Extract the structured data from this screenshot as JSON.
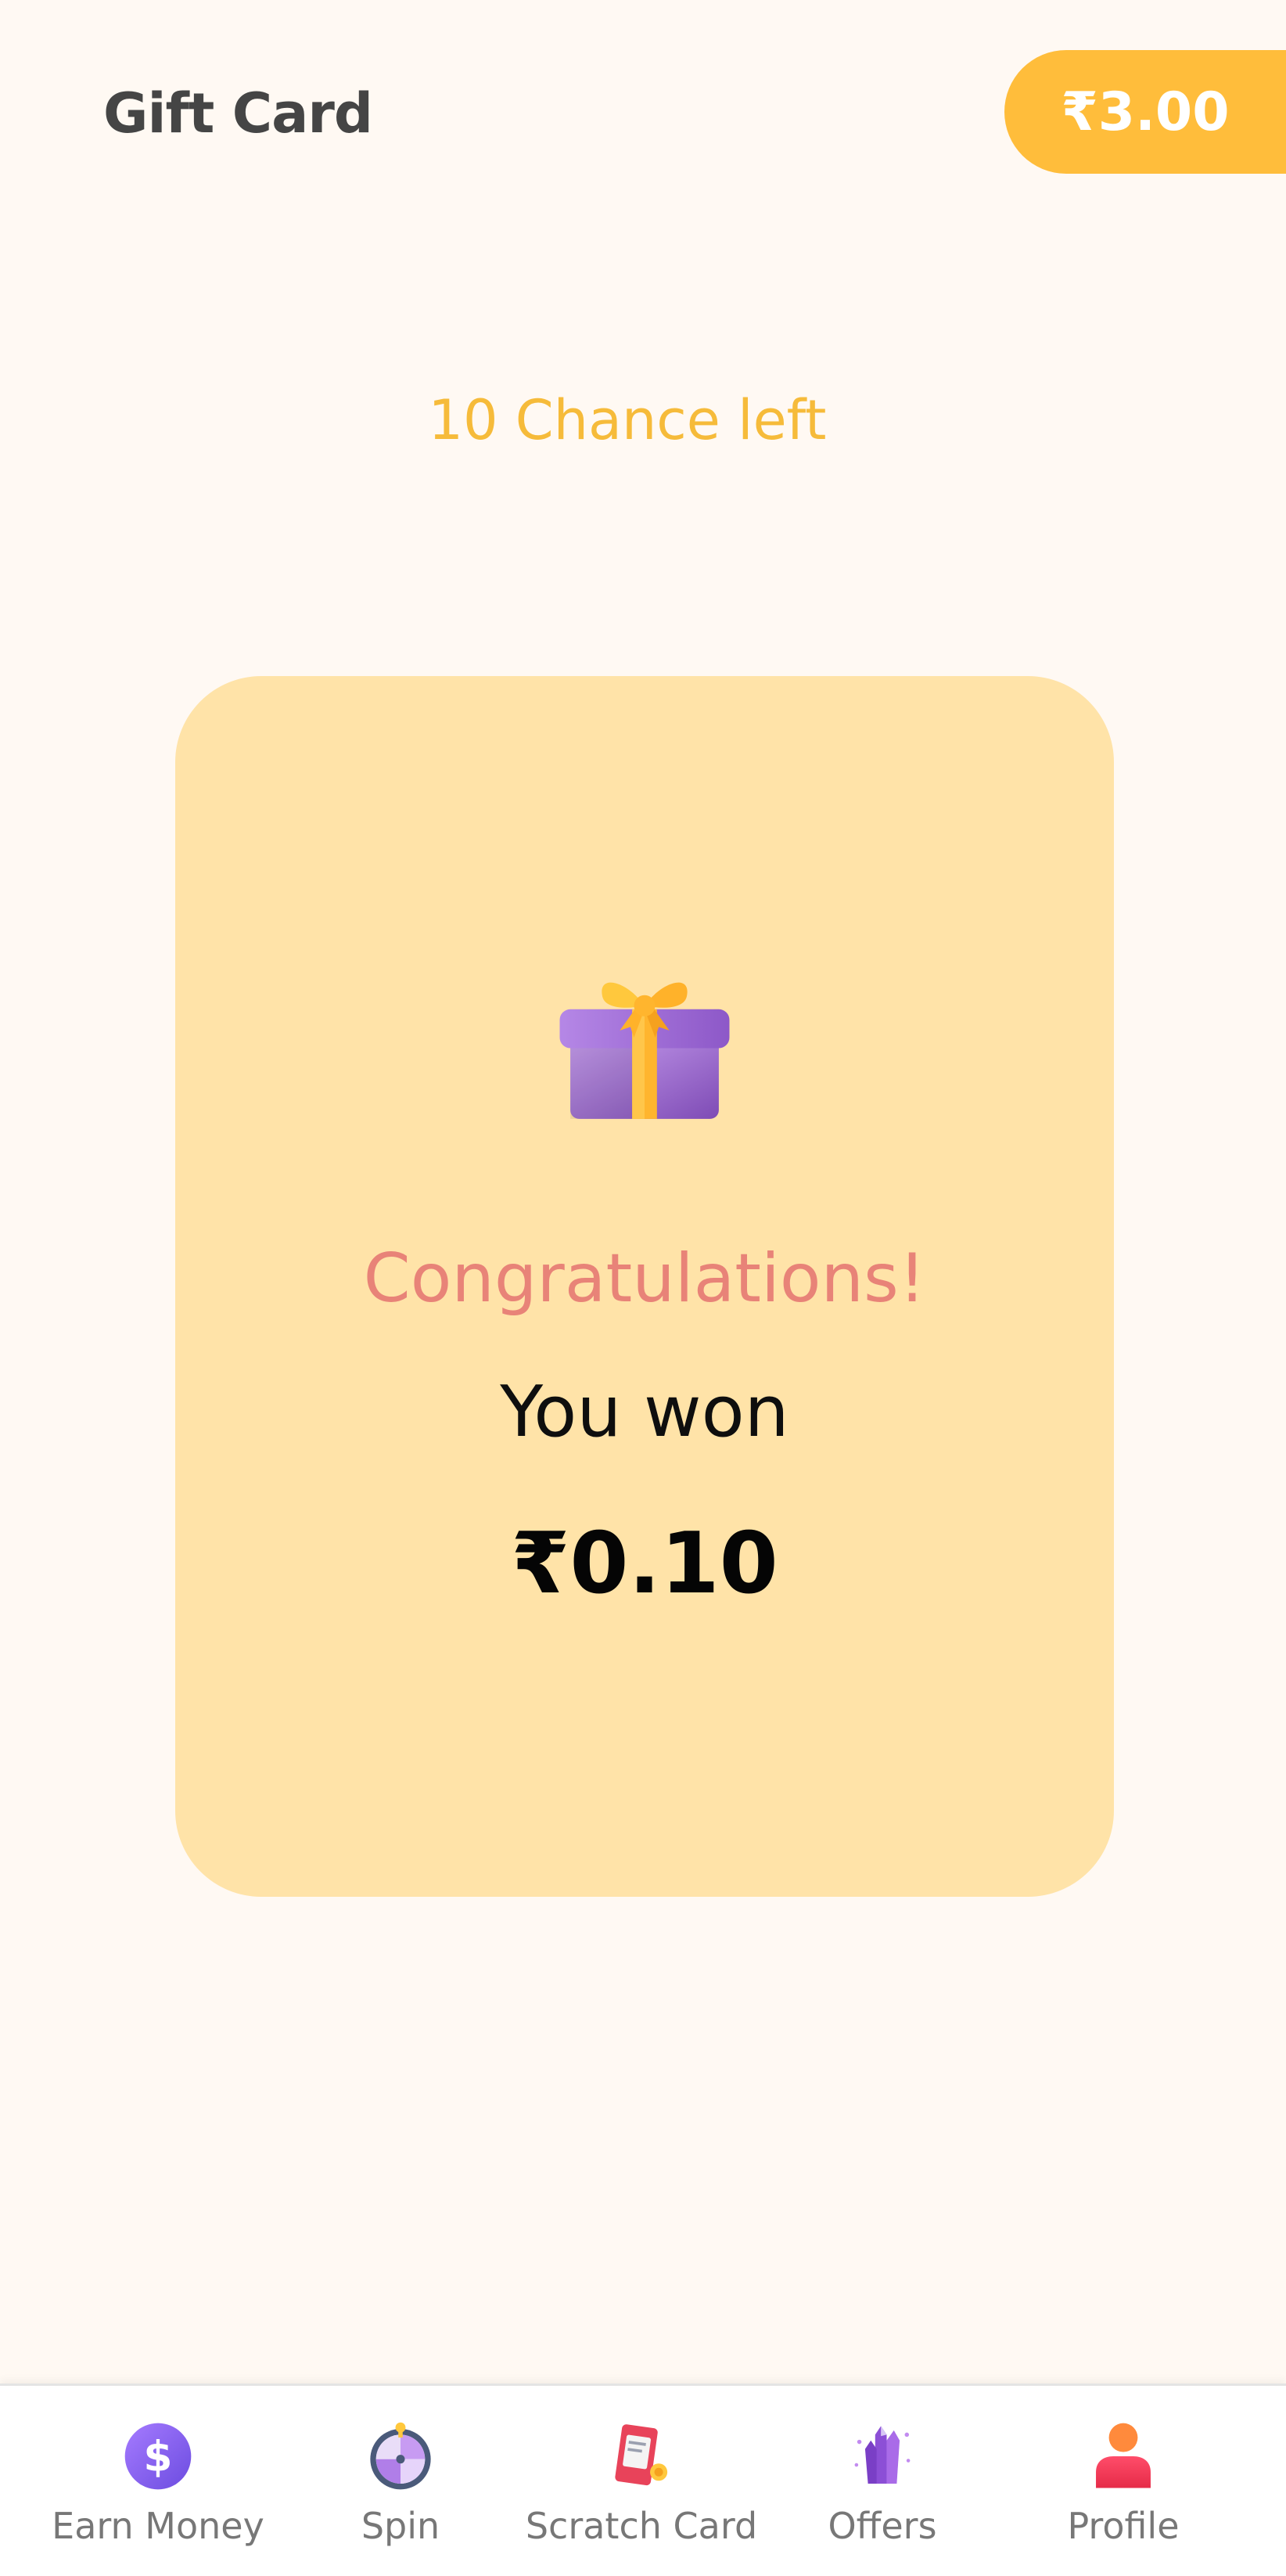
{
  "header": {
    "title": "Gift Card",
    "balance": "₹3.00"
  },
  "game": {
    "chances_left": "10 Chance left"
  },
  "result_card": {
    "icon": "gift-box-icon",
    "heading": "Congratulations!",
    "message": "You won",
    "amount": "₹0.10"
  },
  "bottom_nav": {
    "items": [
      {
        "label": "Earn Money",
        "icon": "dollar-coin-icon"
      },
      {
        "label": "Spin",
        "icon": "spin-wheel-icon"
      },
      {
        "label": "Scratch Card",
        "icon": "scratch-card-icon"
      },
      {
        "label": "Offers",
        "icon": "crystal-icon"
      },
      {
        "label": "Profile",
        "icon": "user-icon"
      }
    ]
  },
  "colors": {
    "background": "#FFF9F3",
    "accent": "#FFBD3B",
    "card": "#FFE3A8",
    "congrats": "#E88378"
  }
}
